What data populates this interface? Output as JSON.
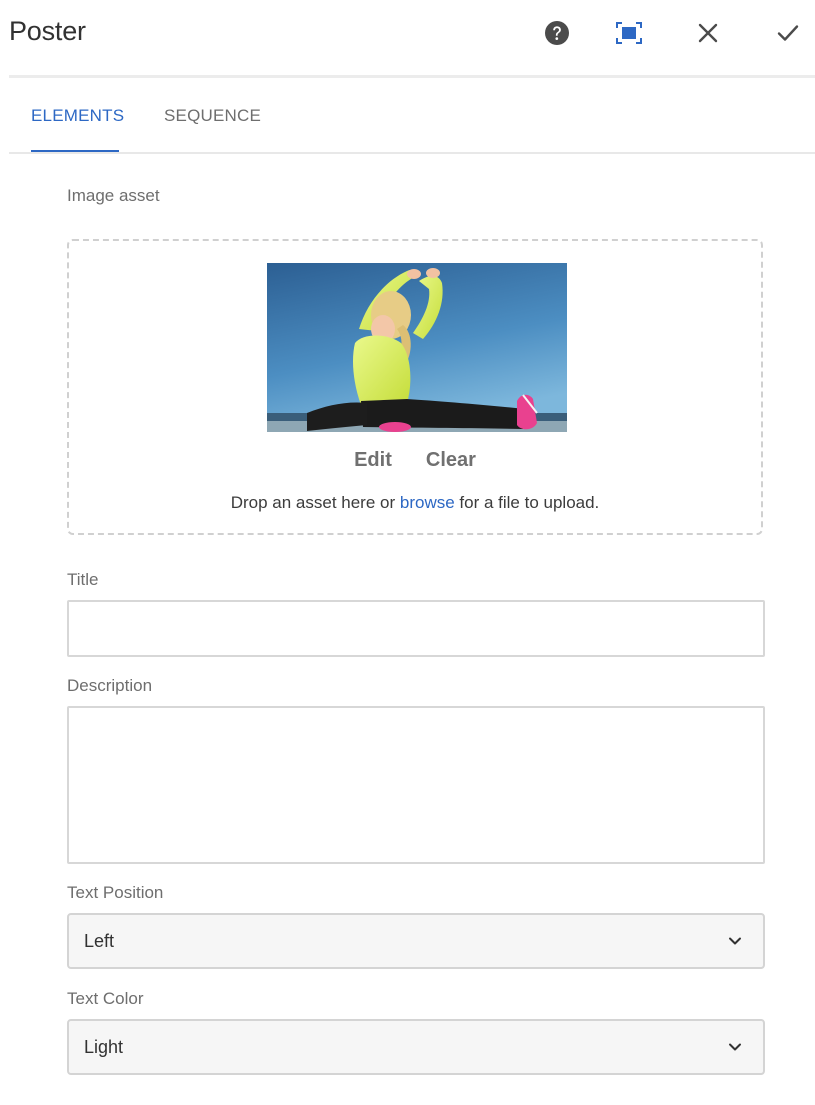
{
  "dialog": {
    "title": "Poster"
  },
  "header_actions": [
    {
      "name": "help",
      "icon": "help-icon"
    },
    {
      "name": "fullscreen",
      "icon": "fullscreen-icon"
    },
    {
      "name": "close",
      "icon": "close-icon"
    },
    {
      "name": "done",
      "icon": "check-icon"
    }
  ],
  "tabs": [
    {
      "label": "ELEMENTS",
      "active": true
    },
    {
      "label": "SEQUENCE",
      "active": false
    }
  ],
  "image_asset": {
    "label": "Image asset",
    "edit_label": "Edit",
    "clear_label": "Clear",
    "drop_before": "Drop an asset here or ",
    "drop_link": "browse",
    "drop_after": " for a file to upload."
  },
  "title_field": {
    "label": "Title",
    "value": "",
    "placeholder": ""
  },
  "description_field": {
    "label": "Description",
    "value": "",
    "placeholder": ""
  },
  "text_position": {
    "label": "Text Position",
    "selected": "Left"
  },
  "text_color": {
    "label": "Text Color",
    "selected": "Light"
  },
  "colors": {
    "accent": "#2d68c4",
    "text": "#323232",
    "muted": "#6e6e6e",
    "border": "#d7d7d7"
  }
}
